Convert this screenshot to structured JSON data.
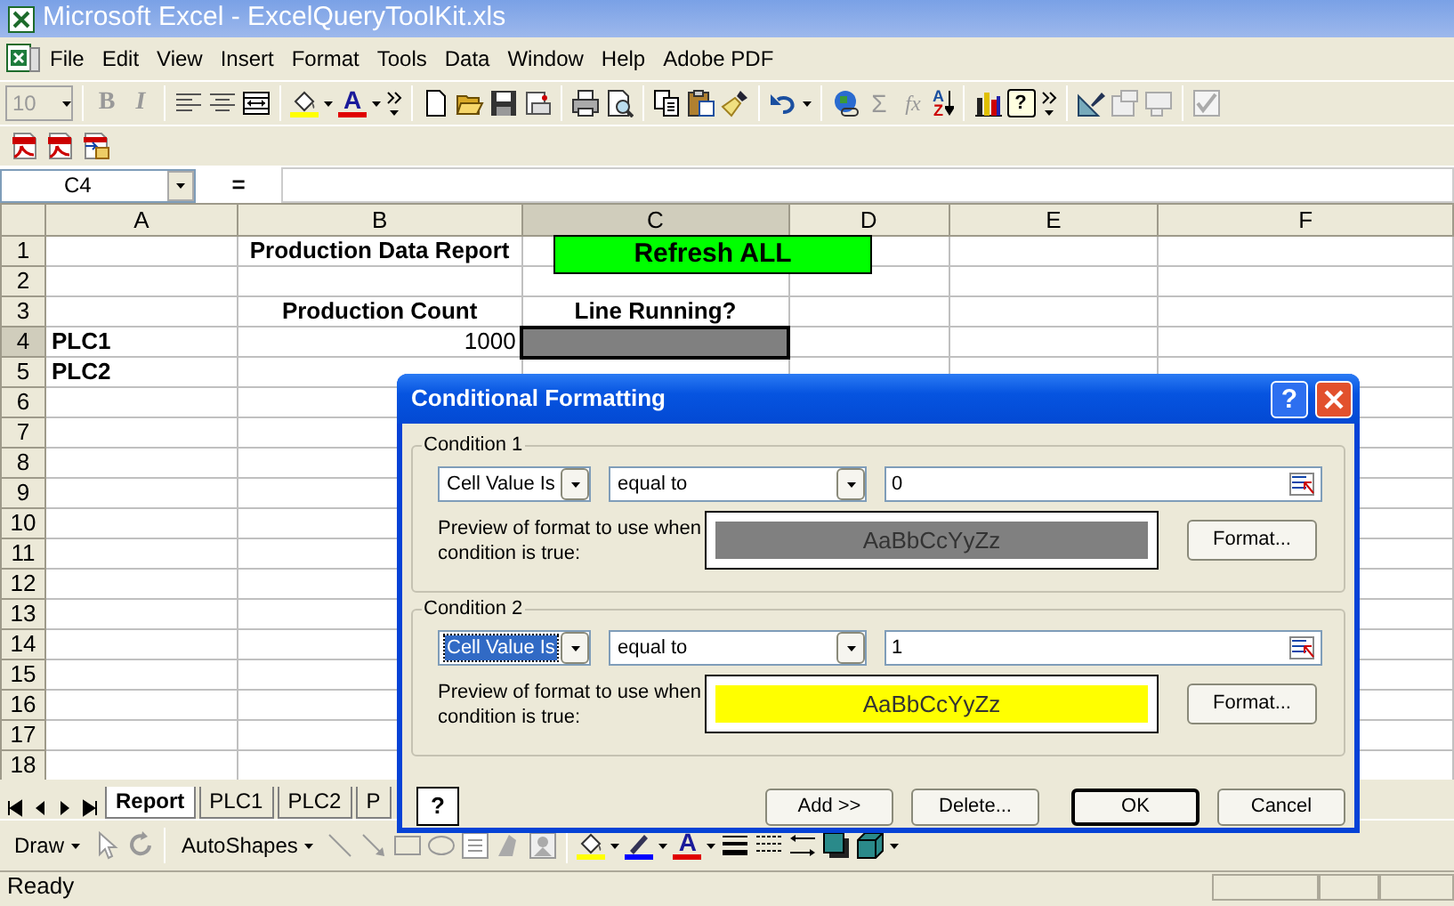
{
  "window": {
    "title": "Microsoft Excel - ExcelQueryToolKit.xls"
  },
  "menu": [
    "File",
    "Edit",
    "View",
    "Insert",
    "Format",
    "Tools",
    "Data",
    "Window",
    "Help",
    "Adobe PDF"
  ],
  "formatting_toolbar": {
    "font_size": "10",
    "bold": "B",
    "italic": "I",
    "font_color": "A",
    "sum": "Σ",
    "function": "fx",
    "sort_top": "A",
    "sort_bottom": "Z",
    "help": "?"
  },
  "formula_bar": {
    "name_box": "C4",
    "equals": "="
  },
  "sheet": {
    "columns": [
      "A",
      "B",
      "C",
      "D",
      "E",
      "F"
    ],
    "rows": [
      {
        "header": "1",
        "cells": [
          null,
          {
            "text": "Production Data Report",
            "kind": "heading"
          }
        ]
      },
      {
        "header": "2",
        "cells": []
      },
      {
        "header": "3",
        "cells": [
          null,
          {
            "text": "Production Count",
            "kind": "heading"
          },
          {
            "text": "Line Running?",
            "kind": "heading"
          }
        ]
      },
      {
        "header": "4",
        "cells": [
          {
            "text": "PLC1",
            "kind": "label"
          },
          {
            "text": "1000",
            "kind": "number"
          },
          {
            "selected": true,
            "color": "#808080"
          }
        ]
      },
      {
        "header": "5",
        "cells": [
          {
            "text": "PLC2",
            "kind": "label"
          }
        ]
      },
      {
        "header": "6",
        "cells": []
      },
      {
        "header": "7",
        "cells": []
      },
      {
        "header": "8",
        "cells": []
      },
      {
        "header": "9",
        "cells": []
      },
      {
        "header": "10",
        "cells": []
      },
      {
        "header": "11",
        "cells": []
      },
      {
        "header": "12",
        "cells": []
      },
      {
        "header": "13",
        "cells": []
      },
      {
        "header": "14",
        "cells": []
      },
      {
        "header": "15",
        "cells": []
      },
      {
        "header": "16",
        "cells": []
      },
      {
        "header": "17",
        "cells": []
      },
      {
        "header": "18",
        "cells": []
      }
    ],
    "button": {
      "label": "Refresh ALL",
      "color": "#00ff00"
    }
  },
  "sheet_tabs": [
    {
      "label": "Report",
      "selected": true
    },
    {
      "label": "PLC1",
      "selected": false
    },
    {
      "label": "PLC2",
      "selected": false
    },
    {
      "label": "P",
      "selected": false
    }
  ],
  "drawing_toolbar": {
    "draw": "Draw",
    "autoshapes": "AutoShapes",
    "font_color": "A"
  },
  "status_bar": {
    "text": "Ready"
  },
  "dialog": {
    "title": "Conditional Formatting",
    "title_help": "?",
    "help": "?",
    "conditions": [
      {
        "title": "Condition 1",
        "type": {
          "value": "Cell Value Is",
          "focused": false
        },
        "operator": "equal to",
        "value": "0",
        "preview_label": "Preview of format to use when condition is true:",
        "preview": {
          "text": "AaBbCcYyZz",
          "color": "#808080"
        },
        "format_button": "Format..."
      },
      {
        "title": "Condition 2",
        "type": {
          "value": "Cell Value Is",
          "focused": true
        },
        "operator": "equal to",
        "value": "1",
        "preview_label": "Preview of format to use when condition is true:",
        "preview": {
          "text": "AaBbCcYyZz",
          "color": "#ffff00"
        },
        "format_button": "Format..."
      }
    ],
    "buttons": [
      {
        "label": "Add >>",
        "default": false
      },
      {
        "label": "Delete...",
        "default": false
      },
      {
        "label": "OK",
        "default": true
      },
      {
        "label": "Cancel",
        "default": false
      }
    ]
  }
}
